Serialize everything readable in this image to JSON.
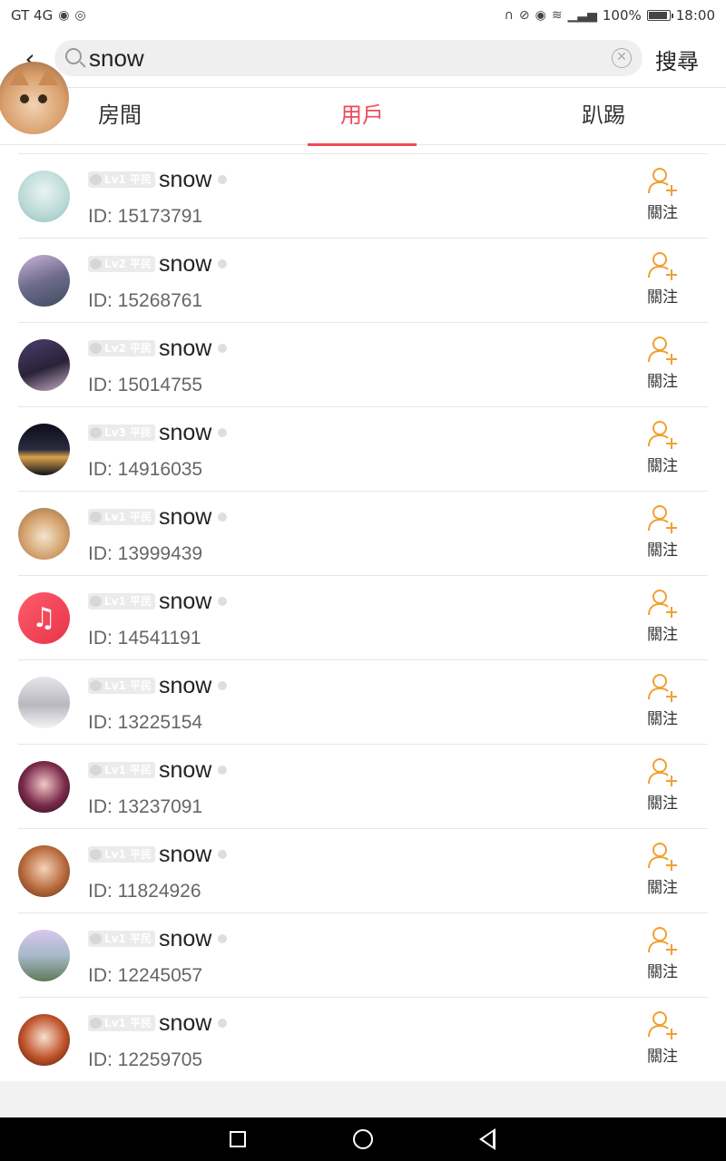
{
  "status_bar": {
    "carrier": "GT 4G",
    "battery": "100%",
    "battery_level": 1.0,
    "time": "18:00"
  },
  "search": {
    "value": "snow",
    "submit_label": "搜尋"
  },
  "tabs": [
    {
      "label": "房間",
      "active": false
    },
    {
      "label": "用戶",
      "active": true
    },
    {
      "label": "趴踢",
      "active": false
    }
  ],
  "accent_color": "#f04a5a",
  "follow_color": "#f0a030",
  "users": [
    {
      "level": "Lv1 平民",
      "name": "snow",
      "id": "ID: 15173791",
      "follow": "關注"
    },
    {
      "level": "Lv2 平民",
      "name": "snow",
      "id": "ID: 15268761",
      "follow": "關注"
    },
    {
      "level": "Lv2 平民",
      "name": "snow",
      "id": "ID: 15014755",
      "follow": "關注"
    },
    {
      "level": "Lv3 平民",
      "name": "snow",
      "id": "ID: 14916035",
      "follow": "關注"
    },
    {
      "level": "Lv1 平民",
      "name": "snow",
      "id": "ID: 13999439",
      "follow": "關注"
    },
    {
      "level": "Lv1 平民",
      "name": "snow",
      "id": "ID: 14541191",
      "follow": "關注"
    },
    {
      "level": "Lv1 平民",
      "name": "snow",
      "id": "ID: 13225154",
      "follow": "關注"
    },
    {
      "level": "Lv1 平民",
      "name": "snow",
      "id": "ID: 13237091",
      "follow": "關注"
    },
    {
      "level": "Lv1 平民",
      "name": "snow",
      "id": "ID: 11824926",
      "follow": "關注"
    },
    {
      "level": "Lv1 平民",
      "name": "snow",
      "id": "ID: 12245057",
      "follow": "關注"
    },
    {
      "level": "Lv1 平民",
      "name": "snow",
      "id": "ID: 12259705",
      "follow": "關注"
    }
  ]
}
